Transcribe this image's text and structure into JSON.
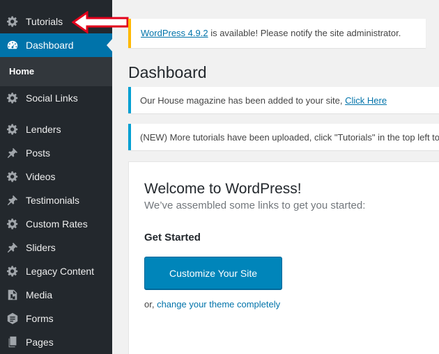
{
  "sidebar": {
    "items": [
      {
        "label": "Tutorials",
        "icon": "gear-icon"
      },
      {
        "label": "Dashboard",
        "icon": "dashboard-icon",
        "active": true
      },
      {
        "label": "Social Links",
        "icon": "gear-icon"
      },
      {
        "label": "Lenders",
        "icon": "gear-icon"
      },
      {
        "label": "Posts",
        "icon": "pin-icon"
      },
      {
        "label": "Videos",
        "icon": "gear-icon"
      },
      {
        "label": "Testimonials",
        "icon": "pin-icon"
      },
      {
        "label": "Custom Rates",
        "icon": "gear-icon"
      },
      {
        "label": "Sliders",
        "icon": "pin-icon"
      },
      {
        "label": "Legacy Content",
        "icon": "gear-icon"
      },
      {
        "label": "Media",
        "icon": "media-icon"
      },
      {
        "label": "Forms",
        "icon": "forms-icon"
      },
      {
        "label": "Pages",
        "icon": "pages-icon"
      }
    ],
    "submenu": {
      "home_label": "Home"
    }
  },
  "update_nag": {
    "link_text": "WordPress 4.9.2",
    "text": " is available! Please notify the site administrator."
  },
  "page_title": "Dashboard",
  "notices": [
    {
      "text": "Our House magazine has been added to your site, ",
      "link_text": "Click Here"
    },
    {
      "text": "(NEW) More tutorials have been uploaded, click \"Tutorials\" in the top left to"
    }
  ],
  "welcome": {
    "title": "Welcome to WordPress!",
    "subtitle": "We’ve assembled some links to get you started:",
    "get_started": "Get Started",
    "customize_button": "Customize Your Site",
    "or_text": "or, ",
    "change_theme_link": "change your theme completely"
  },
  "colors": {
    "sidebar_bg": "#23282d",
    "active_bg": "#0073aa",
    "submenu_bg": "#32373c",
    "update_border": "#ffb900",
    "notice_border": "#00a0d2",
    "primary_button": "#0085ba",
    "link": "#0073aa",
    "annotation_arrow": "#e3001b"
  }
}
